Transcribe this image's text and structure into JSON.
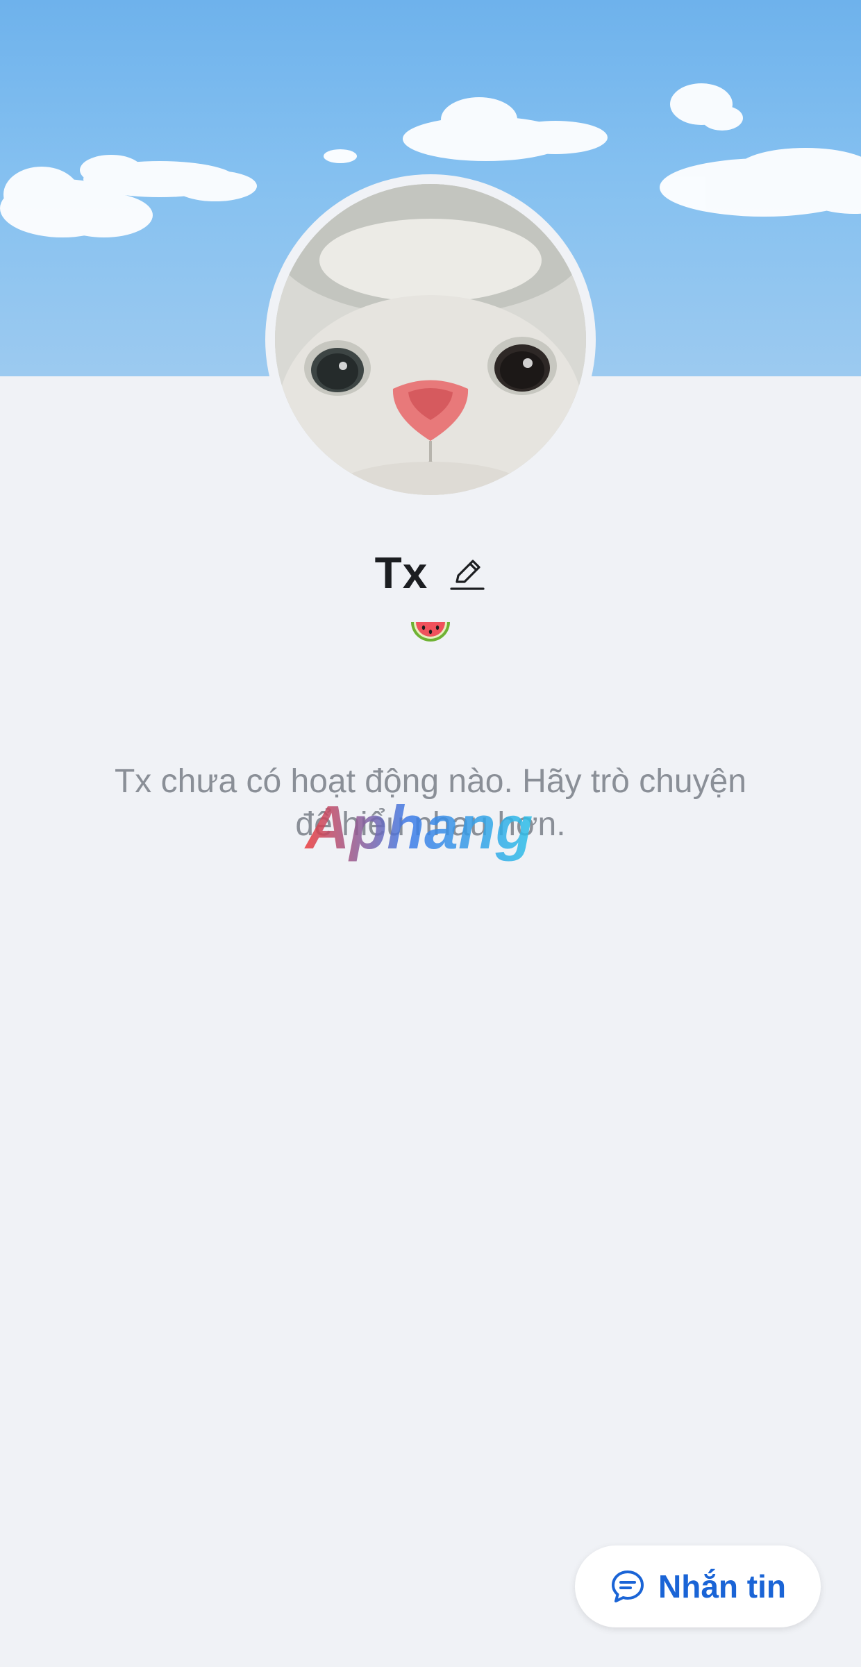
{
  "profile": {
    "name": "Tx",
    "status_emoji": "watermelon",
    "empty_state": "Tx chưa có hoạt động nào. Hãy trò chuyện để hiểu nhau hơn."
  },
  "actions": {
    "message_label": "Nhắn tin"
  },
  "watermark": {
    "text": "Aphang"
  },
  "colors": {
    "accent": "#1a64d6",
    "background": "#f0f2f6",
    "muted_text": "#8a8f97",
    "sky": "#7ab8ee"
  },
  "icons": {
    "edit": "pencil-icon",
    "message": "chat-bubble-icon",
    "status": "watermelon-icon"
  }
}
